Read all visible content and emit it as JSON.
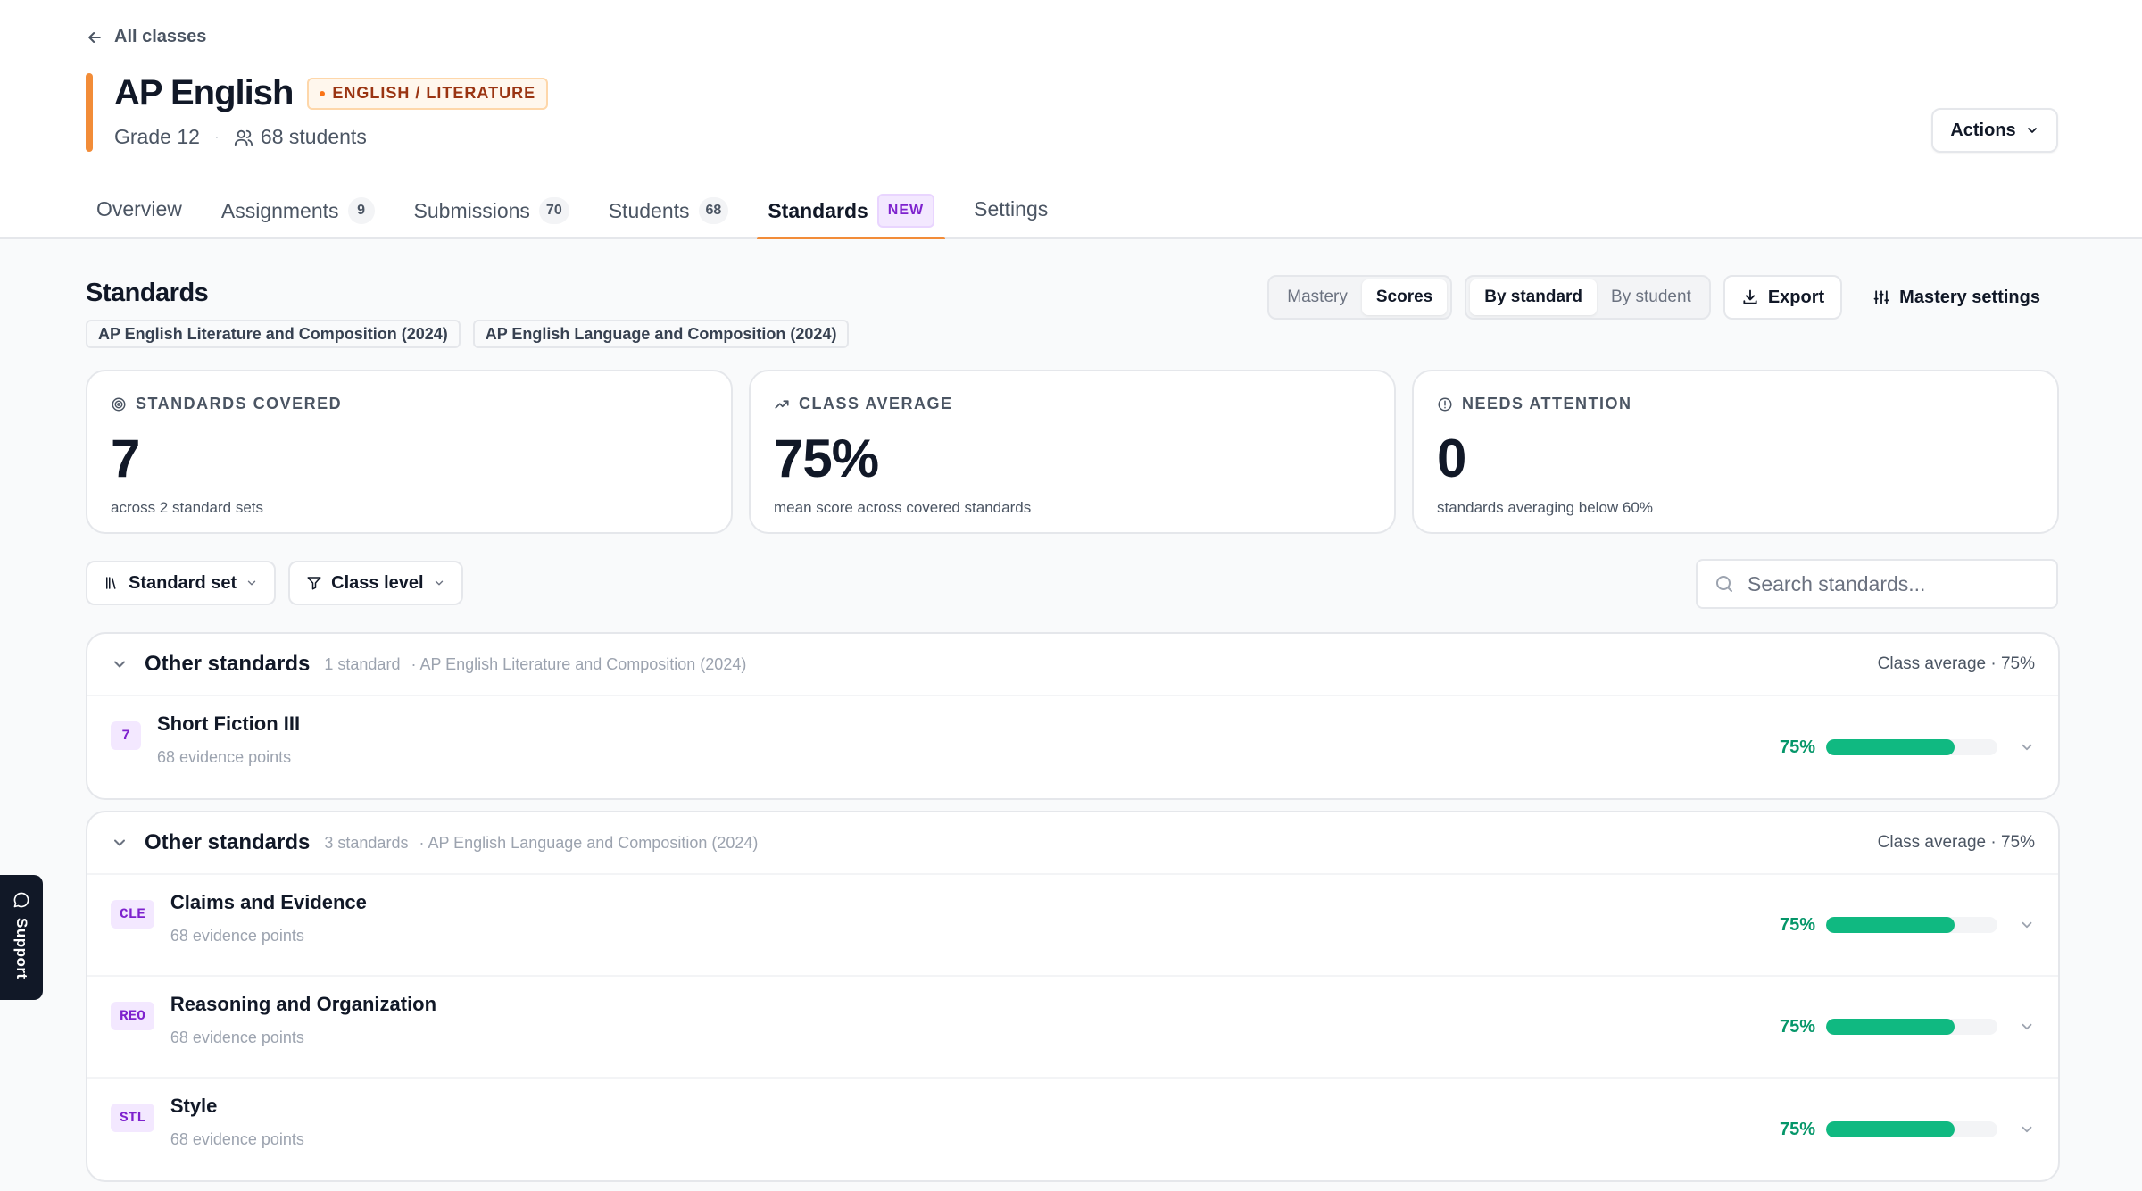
{
  "back_link": "All classes",
  "class": {
    "title": "AP English",
    "subject_badge": "ENGLISH / LITERATURE",
    "grade": "Grade 12",
    "students": "68 students",
    "accent_color": "#f28c38"
  },
  "header_actions": {
    "label": "Actions"
  },
  "tabs": [
    {
      "label": "Overview"
    },
    {
      "label": "Assignments",
      "count": "9"
    },
    {
      "label": "Submissions",
      "count": "70"
    },
    {
      "label": "Students",
      "count": "68"
    },
    {
      "label": "Standards",
      "badge": "NEW",
      "active": true
    },
    {
      "label": "Settings"
    }
  ],
  "standards": {
    "title": "Standards",
    "sets": [
      "AP English Literature and Composition (2024)",
      "AP English Language and Composition (2024)"
    ],
    "view_toggle": {
      "options": [
        "Mastery",
        "Scores"
      ],
      "selected": "Scores"
    },
    "group_toggle": {
      "options": [
        "By standard",
        "By student"
      ],
      "selected": "By standard"
    },
    "export_label": "Export",
    "mastery_settings_label": "Mastery settings"
  },
  "stats": [
    {
      "label": "STANDARDS COVERED",
      "value": "7",
      "sub": "across 2 standard sets",
      "icon": "target-icon"
    },
    {
      "label": "CLASS AVERAGE",
      "value": "75%",
      "sub": "mean score across covered standards",
      "icon": "trending-up-icon"
    },
    {
      "label": "NEEDS ATTENTION",
      "value": "0",
      "sub": "standards averaging below 60%",
      "icon": "alert-circle-icon"
    }
  ],
  "filters": {
    "standard_set": "Standard set",
    "class_level": "Class level",
    "search_placeholder": "Search standards..."
  },
  "groups": [
    {
      "title": "Other standards",
      "count": "1 standard",
      "set": "· AP English Literature and Composition (2024)",
      "average": "Class average · 75%",
      "rows": [
        {
          "code": "7",
          "name": "Short Fiction III",
          "sub": "68 evidence points",
          "pct": "75%",
          "value": 0.75
        }
      ]
    },
    {
      "title": "Other standards",
      "count": "3 standards",
      "set": "· AP English Language and Composition (2024)",
      "average": "Class average · 75%",
      "rows": [
        {
          "code": "CLE",
          "name": "Claims and Evidence",
          "sub": "68 evidence points",
          "pct": "75%",
          "value": 0.75
        },
        {
          "code": "REO",
          "name": "Reasoning and Organization",
          "sub": "68 evidence points",
          "pct": "75%",
          "value": 0.75
        },
        {
          "code": "STL",
          "name": "Style",
          "sub": "68 evidence points",
          "pct": "75%",
          "value": 0.75
        }
      ]
    }
  ],
  "support_label": "Support",
  "colors": {
    "progress": "#10b981",
    "percent_text": "#059669",
    "code_badge_bg": "#f3e8ff",
    "code_badge_text": "#7e22ce"
  }
}
